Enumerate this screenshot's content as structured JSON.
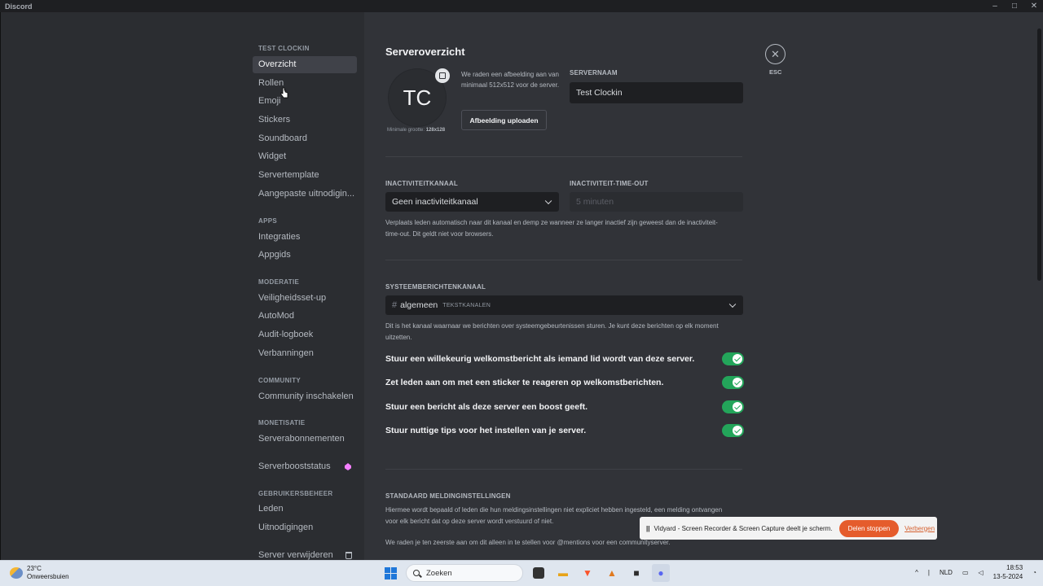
{
  "window": {
    "title": "Discord"
  },
  "sidebar": {
    "categories": {
      "server": "TEST CLOCKIN",
      "apps": "APPS",
      "moderation": "MODERATIE",
      "community": "COMMUNITY",
      "monetization": "MONETISATIE",
      "users": "GEBRUIKERSBEHEER"
    },
    "items": [
      "Overzicht",
      "Rollen",
      "Emoji",
      "Stickers",
      "Soundboard",
      "Widget",
      "Servertemplate",
      "Aangepaste uitnodigin...",
      "Integraties",
      "Appgids",
      "Veiligheidsset-up",
      "AutoMod",
      "Audit-logboek",
      "Verbanningen",
      "Community inschakelen",
      "Serverabonnementen",
      "Serverbooststatus",
      "Leden",
      "Uitnodigingen",
      "Server verwijderen"
    ]
  },
  "main": {
    "title": "Serveroverzicht",
    "avatar_initials": "TC",
    "min_size_label": "Minimale grootte:",
    "min_size_value": "128x128",
    "recommendation": "We raden een afbeelding aan van minimaal 512x512 voor de server.",
    "upload_button": "Afbeelding uploaden",
    "server_name_label": "SERVERNAAM",
    "server_name_value": "Test Clockin",
    "inactive_channel_label": "INACTIVITEITKANAAL",
    "inactive_channel_value": "Geen inactiviteitkanaal",
    "inactive_timeout_label": "INACTIVITEIT-TIME-OUT",
    "inactive_timeout_value": "5 minuten",
    "inactive_help": "Verplaats leden automatisch naar dit kanaal en demp ze wanneer ze langer inactief zijn geweest dan de inactiviteit-time-out. Dit geldt niet voor browsers.",
    "system_channel_label": "SYSTEEMBERICHTENKANAAL",
    "system_channel_value": "algemeen",
    "system_channel_category": "TEKSTKANALEN",
    "system_help": "Dit is het kanaal waarnaar we berichten over systeemgebeurtenissen sturen. Je kunt deze berichten op elk moment uitzetten.",
    "toggles": [
      {
        "label": "Stuur een willekeurig welkomstbericht als iemand lid wordt van deze server.",
        "on": true
      },
      {
        "label": "Zet leden aan om met een sticker te reageren op welkomstberichten.",
        "on": true
      },
      {
        "label": "Stuur een bericht als deze server een boost geeft.",
        "on": true
      },
      {
        "label": "Stuur nuttige tips voor het instellen van je server.",
        "on": true
      }
    ],
    "notif_label": "STANDAARD MELDINGINSTELLINGEN",
    "notif_help": "Hiermee wordt bepaald of leden die hun meldingsinstellingen niet expliciet hebben ingesteld, een melding ontvangen voor elk bericht dat op deze server wordt verstuurd of niet.",
    "notif_help2": "We raden je ten zeerste aan om dit alleen in te stellen voor @mentions voor een communityserver.",
    "close_label": "ESC"
  },
  "share_bar": {
    "text": "Vidyard - Screen Recorder & Screen Capture deelt je scherm.",
    "stop": "Deel stoppen",
    "stop_label": "Delen stoppen",
    "hide": "Verbergen"
  },
  "taskbar": {
    "temp": "23°C",
    "weather": "Onweersbuien",
    "search": "Zoeken",
    "lang": "NLD",
    "time": "18:53",
    "date": "13-5-2024"
  },
  "colors": {
    "accent_toggle": "#23a55a",
    "stop_button": "#e55c2c",
    "boost": "#f47fff"
  }
}
